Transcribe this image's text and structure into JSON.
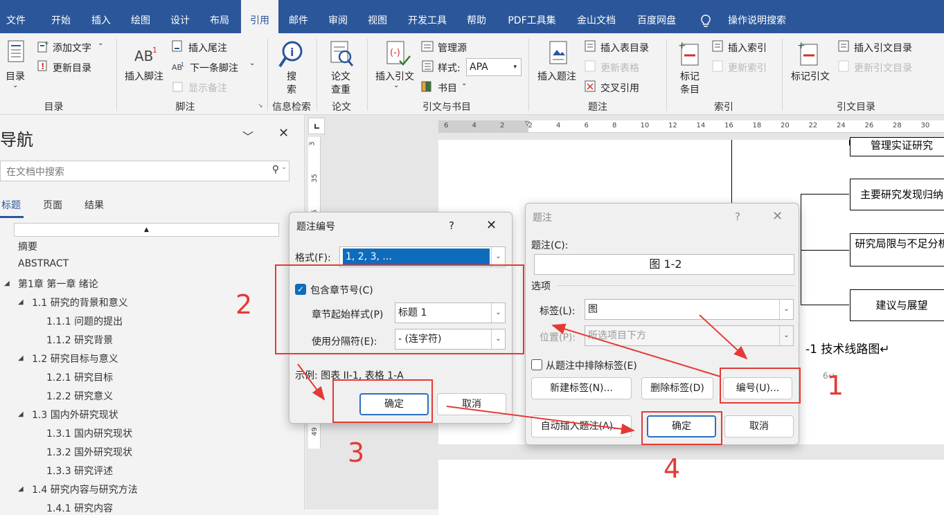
{
  "tabs": [
    "文件",
    "开始",
    "插入",
    "绘图",
    "设计",
    "布局",
    "引用",
    "邮件",
    "审阅",
    "视图",
    "开发工具",
    "帮助",
    "PDF工具集",
    "金山文档",
    "百度网盘",
    "操作说明搜索"
  ],
  "ribbon": {
    "toc": {
      "btn": "目录",
      "add_text": "添加文字",
      "update": "更新目录",
      "group": "目录"
    },
    "footnotes": {
      "insert": "插入脚注",
      "insert_end": "插入尾注",
      "next": "下一条脚注",
      "show": "显示备注",
      "group": "脚注"
    },
    "research": {
      "search1": "搜",
      "search2": "索",
      "group": "信息检索"
    },
    "paper": {
      "check1": "论文",
      "check2": "查重",
      "group": "论文"
    },
    "citations": {
      "insert": "插入引文",
      "manage": "管理源",
      "style_label": "样式:",
      "style_value": "APA",
      "biblio": "书目",
      "group": "引文与书目"
    },
    "captions": {
      "insert": "插入题注",
      "tof": "插入表目录",
      "update_table": "更新表格",
      "crossref": "交叉引用",
      "group": "题注"
    },
    "index": {
      "mark1": "标记",
      "mark2": "条目",
      "insert": "插入索引",
      "update": "更新索引",
      "group": "索引"
    },
    "toa": {
      "mark": "标记引文",
      "insert": "插入引文目录",
      "update": "更新引文目录",
      "group": "引文目录"
    }
  },
  "nav": {
    "title": "导航",
    "search_placeholder": "在文档中搜索",
    "tabs": [
      "标题",
      "页面",
      "结果"
    ],
    "items": [
      {
        "label": "摘要",
        "level": 1,
        "caret": false
      },
      {
        "label": "ABSTRACT",
        "level": 1,
        "caret": false
      },
      {
        "label": "第1章 第一章 绪论",
        "level": 1,
        "caret": true
      },
      {
        "label": "1.1 研究的背景和意义",
        "level": 2,
        "caret": true
      },
      {
        "label": "1.1.1 问题的提出",
        "level": 3,
        "caret": false
      },
      {
        "label": "1.1.2 研究背景",
        "level": 3,
        "caret": false
      },
      {
        "label": "1.2 研究目标与意义",
        "level": 2,
        "caret": true
      },
      {
        "label": "1.2.1 研究目标",
        "level": 3,
        "caret": false
      },
      {
        "label": "1.2.2 研究意义",
        "level": 3,
        "caret": false
      },
      {
        "label": "1.3 国内外研究现状",
        "level": 2,
        "caret": true
      },
      {
        "label": "1.3.1 国内研究现状",
        "level": 3,
        "caret": false
      },
      {
        "label": "1.3.2 国外研究现状",
        "level": 3,
        "caret": false
      },
      {
        "label": "1.3.3 研究评述",
        "level": 3,
        "caret": false
      },
      {
        "label": "1.4 研究内容与研究方法",
        "level": 2,
        "caret": true
      },
      {
        "label": "1.4.1 研究内容",
        "level": 3,
        "caret": false
      }
    ]
  },
  "ruler": {
    "top": [
      "6",
      "4",
      "2",
      "2",
      "4",
      "6",
      "8",
      "10",
      "12",
      "14",
      "16",
      "18",
      "20",
      "22",
      "24",
      "26",
      "28",
      "30"
    ],
    "left": [
      "3",
      "35",
      "36",
      "37",
      "49"
    ]
  },
  "document": {
    "boxes": [
      "管理实证研究",
      "主要研究发现归纳",
      "研究局限与不足分析",
      "建议与展望"
    ],
    "caption_text": "-1 技术线路图↵",
    "para_mark": "6↵"
  },
  "dialog_numbering": {
    "title": "题注编号",
    "help": "?",
    "format_label": "格式(F):",
    "format_value": "1, 2, 3, ...",
    "include_chapter": "包含章节号(C)",
    "chapter_style_label": "章节起始样式(P)",
    "chapter_style_value": "标题 1",
    "separator_label": "使用分隔符(E):",
    "separator_value": "-     (连字符)",
    "example": "示例:  图表 II-1, 表格 1-A",
    "ok": "确定",
    "cancel": "取消"
  },
  "dialog_caption": {
    "title": "题注",
    "help": "?",
    "caption_label": "题注(C):",
    "caption_value": "图  1-2",
    "options_label": "选项",
    "label_label": "标签(L):",
    "label_value": "图",
    "position_label": "位置(P):",
    "position_value": "所选项目下方",
    "exclude_label": "从题注中排除标签(E)",
    "new_label": "新建标签(N)...",
    "delete_label": "删除标签(D)",
    "numbering": "编号(U)...",
    "autocaption": "自动插入题注(A)...",
    "ok": "确定",
    "cancel": "取消"
  },
  "annotations": [
    "1",
    "2",
    "3",
    "4"
  ],
  "colors": {
    "ribbon_blue": "#2b579a",
    "annotation_red": "#e53935",
    "checkbox_blue": "#0f6cbd"
  }
}
